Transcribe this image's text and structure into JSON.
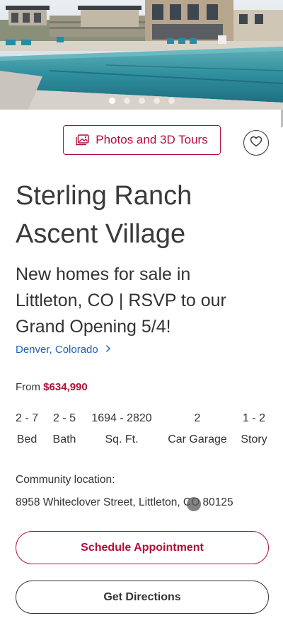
{
  "hero": {
    "slide_count": 5,
    "active_slide": 0
  },
  "actions": {
    "photos_label": "Photos and 3D Tours",
    "favorite_icon": "heart-icon"
  },
  "community": {
    "title_line1": "Sterling Ranch",
    "title_line2": "Ascent Village",
    "headline": "New homes for sale in Littleton, CO | RSVP to our Grand Opening 5/4!",
    "location_link": "Denver, Colorado",
    "price_prefix": "From",
    "price": "$634,990"
  },
  "stats": [
    {
      "value": "2 - 7",
      "label": "Bed"
    },
    {
      "value": "2 - 5",
      "label": "Bath"
    },
    {
      "value": "1694 - 2820",
      "label": "Sq. Ft."
    },
    {
      "value": "2",
      "label": "Car Garage"
    },
    {
      "value": "1 - 2",
      "label": "Story"
    }
  ],
  "address": {
    "label": "Community location:",
    "value": "8958 Whiteclover Street, Littleton, CO 80125"
  },
  "buttons": {
    "schedule": "Schedule Appointment",
    "directions": "Get Directions"
  },
  "colors": {
    "accent": "#b0103a",
    "link": "#1a62b4",
    "text": "#333333"
  }
}
